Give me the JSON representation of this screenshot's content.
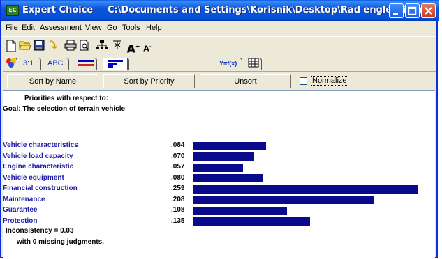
{
  "window": {
    "app_name": "Expert Choice",
    "file_path": "C:\\Documents and Settings\\Korisnik\\Desktop\\Rad engleski.ahp",
    "app_icon_text": "EC"
  },
  "menu": [
    "File",
    "Edit",
    "Assessment",
    "View",
    "Go",
    "Tools",
    "Help"
  ],
  "toolbar_icons": [
    "new-file-icon",
    "open-folder-icon",
    "save-icon",
    "undo-icon",
    "print-icon",
    "print-preview-icon",
    "tree-icon",
    "formula-icon",
    "font-larger-icon",
    "font-smaller-icon"
  ],
  "tabs": {
    "ratio": "3:1",
    "abc": "ABC",
    "yfx": "Y=f(x)"
  },
  "buttons": {
    "sort_by_name": "Sort by Name",
    "sort_by_priority": "Sort by Priority",
    "unsort": "Unsort",
    "normalize": "Normalize",
    "normalize_checked": false
  },
  "report": {
    "heading": "Priorities with respect to:",
    "goal": "Goal: The selection of terrain vehicle",
    "inconsistency": "Inconsistency = 0.03",
    "missing": "with 0  missing judgments."
  },
  "chart_data": {
    "type": "bar",
    "orientation": "horizontal",
    "categories": [
      "Vehicle characteristics",
      "Vehicle load capacity",
      "Engine characteristic",
      "Vehicle equipment",
      "Financial construction",
      "Maintenance",
      "Guarantee",
      "Protection"
    ],
    "values": [
      0.084,
      0.07,
      0.057,
      0.08,
      0.259,
      0.208,
      0.108,
      0.135
    ],
    "value_labels": [
      ".084",
      ".070",
      ".057",
      ".080",
      ".259",
      ".208",
      ".108",
      ".135"
    ],
    "bar_color": "#0a0a8c"
  }
}
